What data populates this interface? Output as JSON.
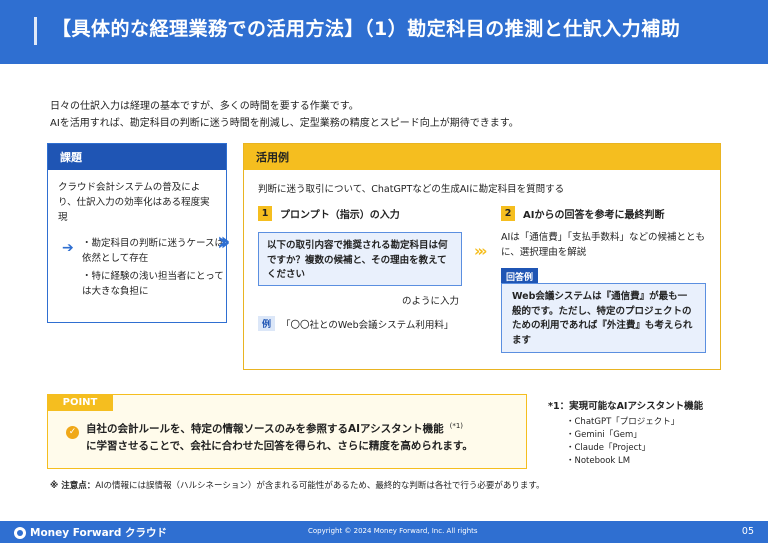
{
  "header": {
    "title": "【具体的な経理業務での活用方法】（1）勘定科目の推測と仕訳入力補助"
  },
  "intro": {
    "line1": "日々の仕訳入力は経理の基本ですが、多くの時間を要する作業です。",
    "line2": "AIを活用すれば、勘定科目の判断に迷う時間を削減し、定型業務の精度とスピード向上が期待できます。"
  },
  "issue": {
    "title": "課題",
    "body": "クラウド会計システムの普及により、仕訳入力の効率化はある程度実現",
    "bullet1": "・勘定科目の判断に迷うケースは依然として存在",
    "bullet2": "・特に経験の浅い担当者にとっては大きな負担に"
  },
  "usecase": {
    "title": "活用例",
    "intro": "判断に迷う取引について、ChatGPTなどの生成AIに勘定科目を質問する",
    "step1_num": "1",
    "step1_label": "プロンプト（指示）の入力",
    "prompt": "以下の取引内容で推奨される勘定科目は何ですか？複数の候補と、その理由を教えてください",
    "prompt_suffix": "のように入力",
    "example_tag": "例",
    "example_text": "「〇〇社とのWeb会議システム利用料」",
    "step2_num": "2",
    "step2_label": "AIからの回答を参考に最終判断",
    "ai_text": "AIは「通信費」「支払手数料」などの候補とともに、選択理由を解説",
    "answer_tag": "回答例",
    "answer": "Web会議システムは『通信費』が最も一般的です。ただし、特定のプロジェクトのための利用であれば『外注費』も考えられます"
  },
  "point": {
    "tag": "POINT",
    "line1": "自社の会計ルールを、特定の情報ソースのみを参照するAIアシスタント機能",
    "sup": "(*1)",
    "line2": "に学習させることで、会社に合わせた回答を得られ、さらに精度を高められます。"
  },
  "note1": {
    "title": "*1：実現可能なAIアシスタント機能",
    "items": [
      "・ChatGPT「プロジェクト」",
      "・Gemini「Gem」",
      "・Claude「Project」",
      "・Notebook LM"
    ]
  },
  "caution": {
    "label": "※ 注意点：",
    "text": "AIの情報には誤情報（ハルシネーション）が含まれる可能性があるため、最終的な判断は各社で行う必要があります。"
  },
  "footer": {
    "logo": "Money Forward クラウド",
    "copyright": "Copyright © 2024 Money Forward, Inc. All rights",
    "page": "05"
  },
  "colors": {
    "primary": "#2f6fd1",
    "accent": "#f5be1f"
  }
}
